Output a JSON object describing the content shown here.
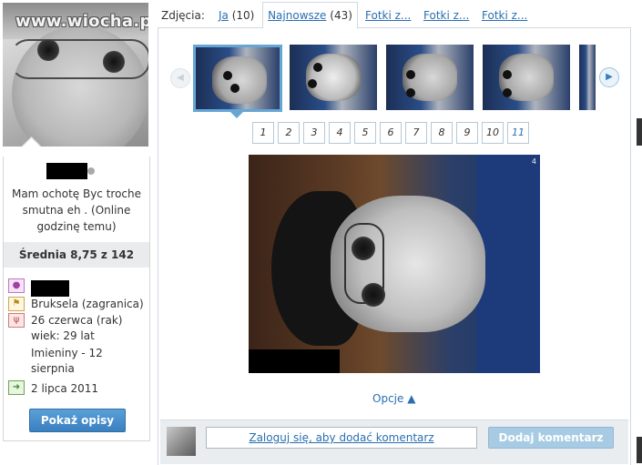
{
  "watermark": "www.wiocha.pl",
  "profile": {
    "status_text": "Mam ochotę Byc troche smutna eh . (Online godzinę temu)",
    "rating_label": "Średnia 8,75 z 142",
    "location": "Bruksela (zagranica)",
    "birthday": "26 czerwca (rak)",
    "age": "wiek: 29 lat",
    "nameday": "Imieniny - 12 sierpnia",
    "joined": "2 lipca 2011",
    "show_descriptions_button": "Pokaż opisy"
  },
  "tabs": {
    "label": "Zdjęcia:",
    "items": [
      {
        "label": "Ja",
        "count": "(10)"
      },
      {
        "label": "Najnowsze",
        "count": "(43)"
      },
      {
        "label": "Fotki z...",
        "count": ""
      },
      {
        "label": "Fotki z...",
        "count": ""
      },
      {
        "label": "Fotki z...",
        "count": ""
      }
    ]
  },
  "carousel": {
    "prev_icon": "arrow-left-icon",
    "next_icon": "arrow-right-icon"
  },
  "pagination": [
    "1",
    "2",
    "3",
    "4",
    "5",
    "6",
    "7",
    "8",
    "9",
    "10",
    "11"
  ],
  "photo": {
    "counter": "4"
  },
  "options_label": "Opcje ▲",
  "comment": {
    "login_prompt": "Zaloguj się, aby dodać komentarz",
    "add_button": "Dodaj komentarz"
  },
  "colors": {
    "accent": "#2a6fb0",
    "button_blue": "#3a7fbf",
    "selected_thumb_border": "#66a6d4"
  }
}
